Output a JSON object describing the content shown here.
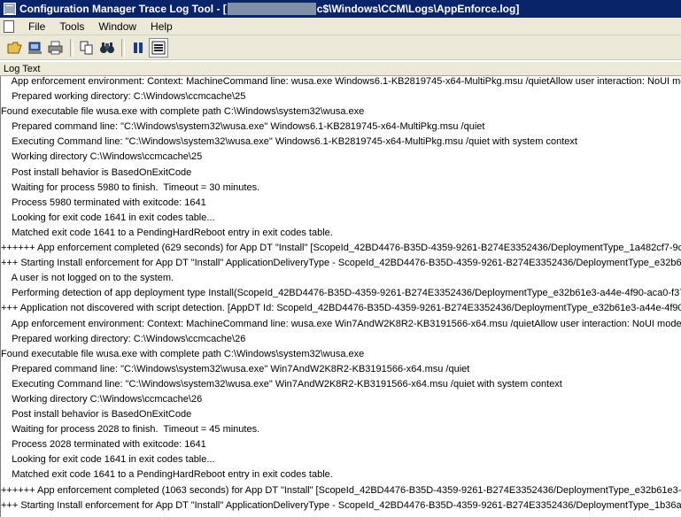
{
  "title": {
    "prefix": "Configuration Manager Trace Log Tool - [",
    "suffix": "c$\\Windows\\CCM\\Logs\\AppEnforce.log]"
  },
  "menu": [
    "File",
    "Tools",
    "Window",
    "Help"
  ],
  "toolbar": [
    "open-icon",
    "print-preview-icon",
    "print-icon",
    "copy-icon",
    "find-icon",
    "pause-icon",
    "highlight-icon"
  ],
  "column_header": "Log Text",
  "log_lines": [
    "    App enforcement environment: Context: MachineCommand line: wusa.exe Windows6.1-KB2819745-x64-MultiPkg.msu /quietAllow user interaction: NoUI mod",
    "    Prepared working directory: C:\\Windows\\ccmcache\\25",
    "Found executable file wusa.exe with complete path C:\\Windows\\system32\\wusa.exe",
    "    Prepared command line: \"C:\\Windows\\system32\\wusa.exe\" Windows6.1-KB2819745-x64-MultiPkg.msu /quiet",
    "    Executing Command line: \"C:\\Windows\\system32\\wusa.exe\" Windows6.1-KB2819745-x64-MultiPkg.msu /quiet with system context",
    "    Working directory C:\\Windows\\ccmcache\\25",
    "    Post install behavior is BasedOnExitCode",
    "    Waiting for process 5980 to finish.  Timeout = 30 minutes.",
    "    Process 5980 terminated with exitcode: 1641",
    "    Looking for exit code 1641 in exit codes table...",
    "    Matched exit code 1641 to a PendingHardReboot entry in exit codes table.",
    "++++++ App enforcement completed (629 seconds) for App DT \"Install\" [ScopeId_42BD4476-B35D-4359-9261-B274E3352436/DeploymentType_1a482cf7-9c",
    "+++ Starting Install enforcement for App DT \"Install\" ApplicationDeliveryType - ScopeId_42BD4476-B35D-4359-9261-B274E3352436/DeploymentType_e32b6",
    "    A user is not logged on to the system.",
    "    Performing detection of app deployment type Install(ScopeId_42BD4476-B35D-4359-9261-B274E3352436/DeploymentType_e32b61e3-a44e-4f90-aca0-f37",
    "+++ Application not discovered with script detection. [AppDT Id: ScopeId_42BD4476-B35D-4359-9261-B274E3352436/DeploymentType_e32b61e3-a44e-4f90",
    "    App enforcement environment: Context: MachineCommand line: wusa.exe Win7AndW2K8R2-KB3191566-x64.msu /quietAllow user interaction: NoUI mode:",
    "    Prepared working directory: C:\\Windows\\ccmcache\\26",
    "Found executable file wusa.exe with complete path C:\\Windows\\system32\\wusa.exe",
    "    Prepared command line: \"C:\\Windows\\system32\\wusa.exe\" Win7AndW2K8R2-KB3191566-x64.msu /quiet",
    "    Executing Command line: \"C:\\Windows\\system32\\wusa.exe\" Win7AndW2K8R2-KB3191566-x64.msu /quiet with system context",
    "    Working directory C:\\Windows\\ccmcache\\26",
    "    Post install behavior is BasedOnExitCode",
    "    Waiting for process 2028 to finish.  Timeout = 45 minutes.",
    "    Process 2028 terminated with exitcode: 1641",
    "    Looking for exit code 1641 in exit codes table...",
    "    Matched exit code 1641 to a PendingHardReboot entry in exit codes table.",
    "++++++ App enforcement completed (1063 seconds) for App DT \"Install\" [ScopeId_42BD4476-B35D-4359-9261-B274E3352436/DeploymentType_e32b61e3-a",
    "+++ Starting Install enforcement for App DT \"Install\" ApplicationDeliveryType - ScopeId_42BD4476-B35D-4359-9261-B274E3352436/DeploymentType_1b36aa"
  ]
}
